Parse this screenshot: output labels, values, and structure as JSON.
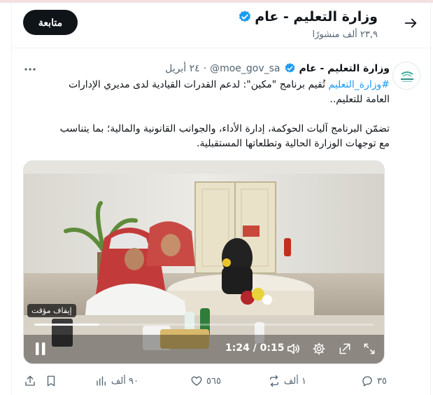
{
  "header": {
    "title": "وزارة التعليم - عام",
    "posts_count": "٢٣,٩ ألف منشورًا",
    "follow_label": "متابعة"
  },
  "tweet": {
    "author_name": "وزارة التعليم - عام",
    "handle": "@moe_gov_sa",
    "date": "٢٤ أبريل",
    "hashtag": "#وزارة_التعليم",
    "text_line1_rest": " تُقيم برنامج \"مكين\": لدعم القدرات القيادية لدى مديري الإدارات العامة للتعليم..",
    "text_para2": "تضمّن البرنامج آليات الحوكمة، إدارة الأداء، والجوانب القانونية والمالية؛ بما يتناسب مع توجهات الوزارة الحالية وتطلعاتها المستقبلية."
  },
  "video": {
    "pause_label": "إيقاف مؤقت",
    "time": "1:24 / 0:15",
    "progress_fraction": 0.19
  },
  "actions": {
    "replies": "٣٥",
    "retweets": "١ ألف",
    "likes": "٥٦٥",
    "views": "٩٠ ألف"
  },
  "colors": {
    "accent": "#1d9bf0",
    "text": "#0f1419",
    "muted": "#536471"
  },
  "icons": [
    "back-arrow-icon",
    "verified-badge-icon",
    "more-icon",
    "pause-icon",
    "volume-icon",
    "settings-icon",
    "minimize-icon",
    "fullscreen-icon",
    "reply-icon",
    "retweet-icon",
    "like-icon",
    "views-icon",
    "bookmark-icon",
    "share-icon"
  ]
}
